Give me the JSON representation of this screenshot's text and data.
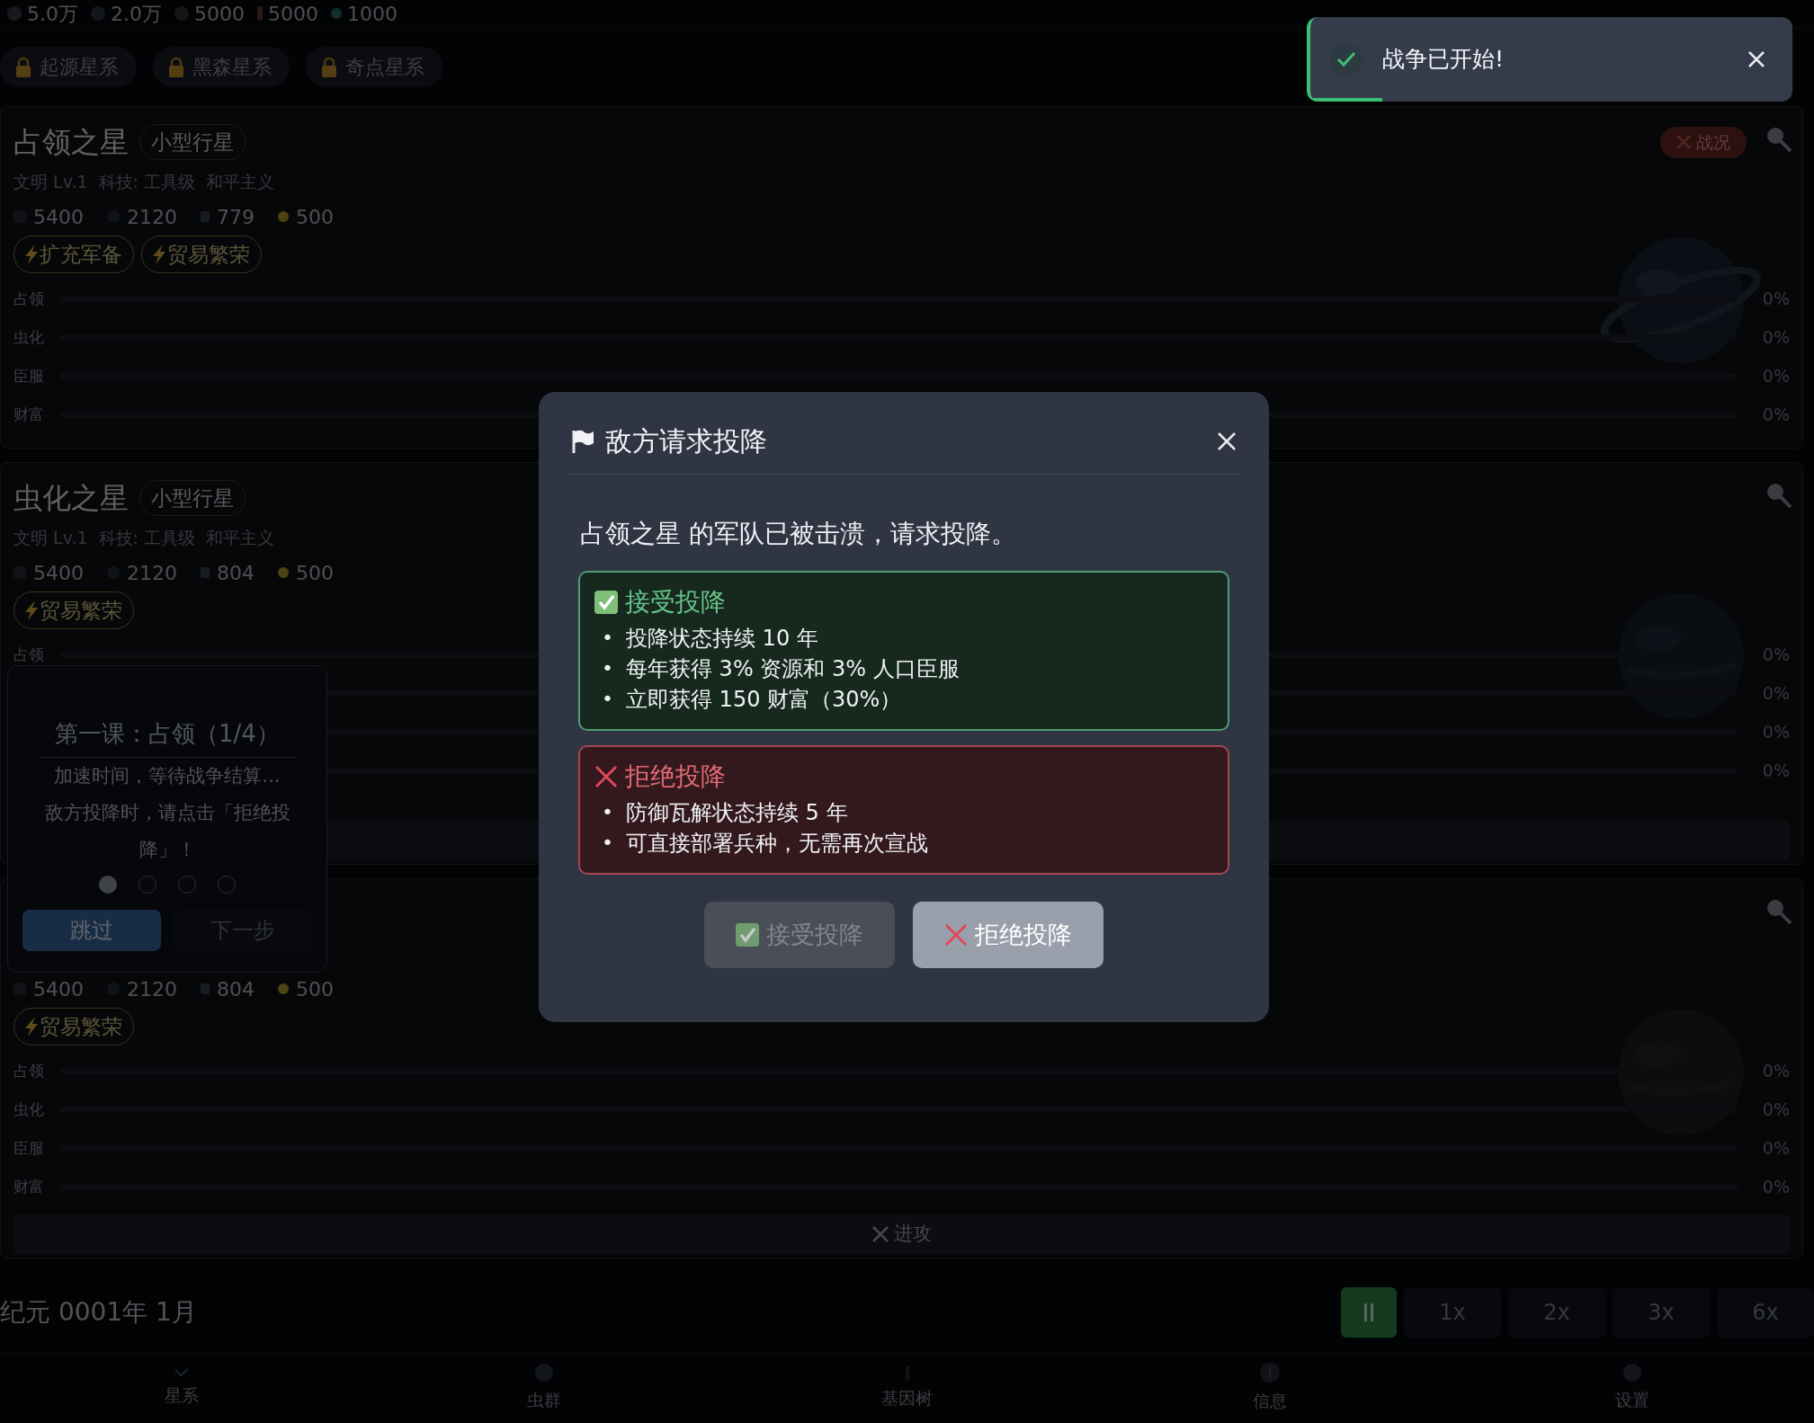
{
  "resources": [
    "5.0万",
    "2.0万",
    "5000",
    "5000",
    "1000"
  ],
  "galaxy_tabs": [
    {
      "label": "起源星系",
      "locked": true
    },
    {
      "label": "黑森星系",
      "locked": true
    },
    {
      "label": "奇点星系",
      "locked": true
    }
  ],
  "planets": [
    {
      "kind": "at_war",
      "name": "占领之星",
      "size": "小型行星",
      "info": [
        "文明 Lv.1",
        "科技: 工具级",
        "和平主义"
      ],
      "stats": [
        "5400",
        "2120",
        "779",
        "500"
      ],
      "tags": [
        "扩充军备",
        "贸易繁荣"
      ],
      "war_badge": "战况",
      "bars": [
        {
          "label": "占领",
          "level": 0,
          "reading": "0%"
        },
        {
          "label": "虫化",
          "level": 0,
          "reading": "0%"
        },
        {
          "label": "臣服",
          "level": 0,
          "reading": "0%"
        },
        {
          "label": "财富",
          "level": 0,
          "reading": "0%"
        }
      ]
    },
    {
      "kind": "idle",
      "name": "虫化之星",
      "size": "小型行星",
      "info": [
        "文明 Lv.1",
        "科技: 工具级",
        "和平主义"
      ],
      "stats": [
        "5400",
        "2120",
        "804",
        "500"
      ],
      "tags": [
        "贸易繁荣"
      ],
      "bars": [
        {
          "label": "占领",
          "level": 0,
          "reading": "0%"
        },
        {
          "level": 0,
          "reading": "0%"
        },
        {
          "level": 0,
          "reading": "0%"
        },
        {
          "level": 0,
          "reading": "0%"
        }
      ]
    },
    {
      "kind": "idle",
      "stats": [
        "5400",
        "2120",
        "804",
        "500"
      ],
      "tags": [
        "贸易繁荣"
      ],
      "bars": [
        {
          "label": "占领",
          "level": 0,
          "reading": "0%"
        },
        {
          "label": "虫化",
          "level": 0,
          "reading": "0%"
        },
        {
          "label": "臣服",
          "level": 0,
          "reading": "0%"
        },
        {
          "label": "财富",
          "level": 0,
          "reading": "0%"
        }
      ],
      "attack_label": "进攻"
    }
  ],
  "date": "纪元 0001年 1月",
  "speeds": [
    {
      "kind": "pause",
      "selected": true
    },
    {
      "kind": "rate",
      "label": "1x",
      "selected": false
    },
    {
      "kind": "rate",
      "label": "2x",
      "selected": false
    },
    {
      "kind": "rate",
      "label": "3x",
      "selected": false
    },
    {
      "kind": "rate",
      "label": "6x",
      "selected": false
    }
  ],
  "nav": [
    {
      "label": "星系"
    },
    {
      "label": "虫群"
    },
    {
      "label": "基因树"
    },
    {
      "label": "信息"
    },
    {
      "label": "设置"
    }
  ],
  "tutorial": {
    "title": "第一课：占领（1/4）",
    "lines": [
      "加速时间，等待战争结算...",
      "敌方投降时，请点击「拒绝投降」！"
    ],
    "steps": [
      {
        "selected": true
      },
      {
        "selected": false
      },
      {
        "selected": false
      },
      {
        "selected": false
      }
    ],
    "buttons": [
      {
        "kind": "primary",
        "label": "跳过"
      },
      {
        "kind": "secondary",
        "label": "下一步"
      }
    ]
  },
  "modal": {
    "title": "敌方请求投降",
    "message": "占领之星 的军队已被击溃，请求投降。",
    "options": [
      {
        "kind": "accept",
        "title": "接受投降",
        "bullet": "•",
        "points": [
          "投降状态持续 10 年",
          "每年获得 3% 资源和 3% 人口臣服",
          "立即获得 150 财富（30%）"
        ]
      },
      {
        "kind": "reject",
        "title": "拒绝投降",
        "bullet": "•",
        "points": [
          "防御瓦解状态持续 5 年",
          "可直接部署兵种，无需再次宣战"
        ]
      }
    ],
    "buttons": [
      {
        "kind": "accept",
        "label": "接受投降",
        "disabled": true
      },
      {
        "kind": "reject",
        "label": "拒绝投降",
        "disabled": false
      }
    ]
  },
  "toast": {
    "message": "战争已开始!",
    "level": 0.15
  }
}
